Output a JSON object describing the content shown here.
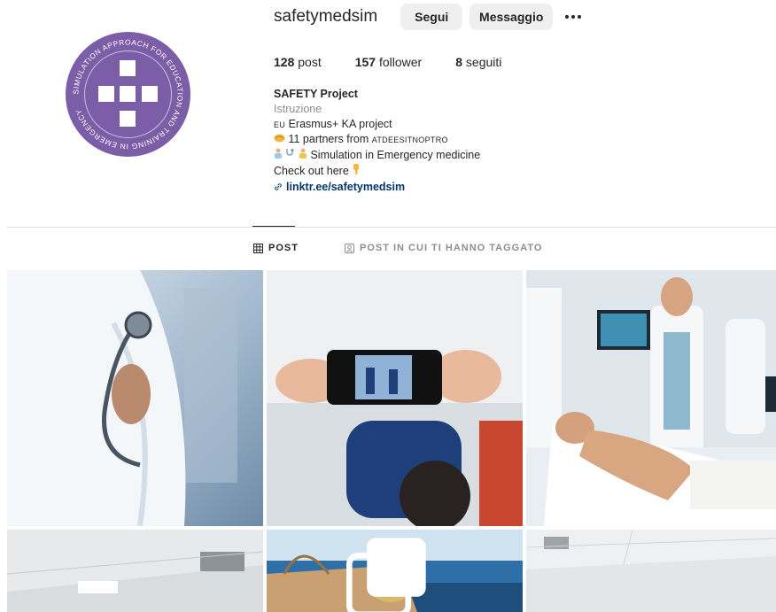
{
  "profile": {
    "username": "safetymedsim",
    "follow_label": "Segui",
    "message_label": "Messaggio",
    "avatar_ring_text": "SIMULATION APPROACH FOR EDUCATION AND TRAINING IN EMERGENCY",
    "avatar_color": "#7b5ea7"
  },
  "stats": {
    "posts_count": "128",
    "posts_label": "post",
    "followers_count": "157",
    "followers_label": "follower",
    "following_count": "8",
    "following_label": "seguiti"
  },
  "bio": {
    "name": "SAFETY Project",
    "category": "Istruzione",
    "line1_flag": "EU",
    "line1": "Erasmus+ KA project",
    "line2_prefix": "11 partners from",
    "line2_flags": "ATDEESITNOPTRO",
    "line3": "Simulation in Emergency medicine",
    "line4": "Check out here",
    "link": "linktr.ee/safetymedsim"
  },
  "tabs": {
    "posts": "POST",
    "tagged": "POST IN CUI TI HANNO TAGGATO"
  },
  "icons": {
    "more": "more-dots-icon",
    "grid": "grid-icon",
    "tagged": "tagged-user-icon",
    "link": "link-icon",
    "handshake": "handshake-emoji-icon",
    "health": "health-worker-emoji-icon",
    "stethoscope": "stethoscope-emoji-icon",
    "point_down": "pointing-down-emoji-icon",
    "carousel": "carousel-icon"
  },
  "colors": {
    "link": "#00376b",
    "muted": "#8e8e8e",
    "button_bg": "#efefef",
    "brand_purple": "#7b5ea7"
  }
}
